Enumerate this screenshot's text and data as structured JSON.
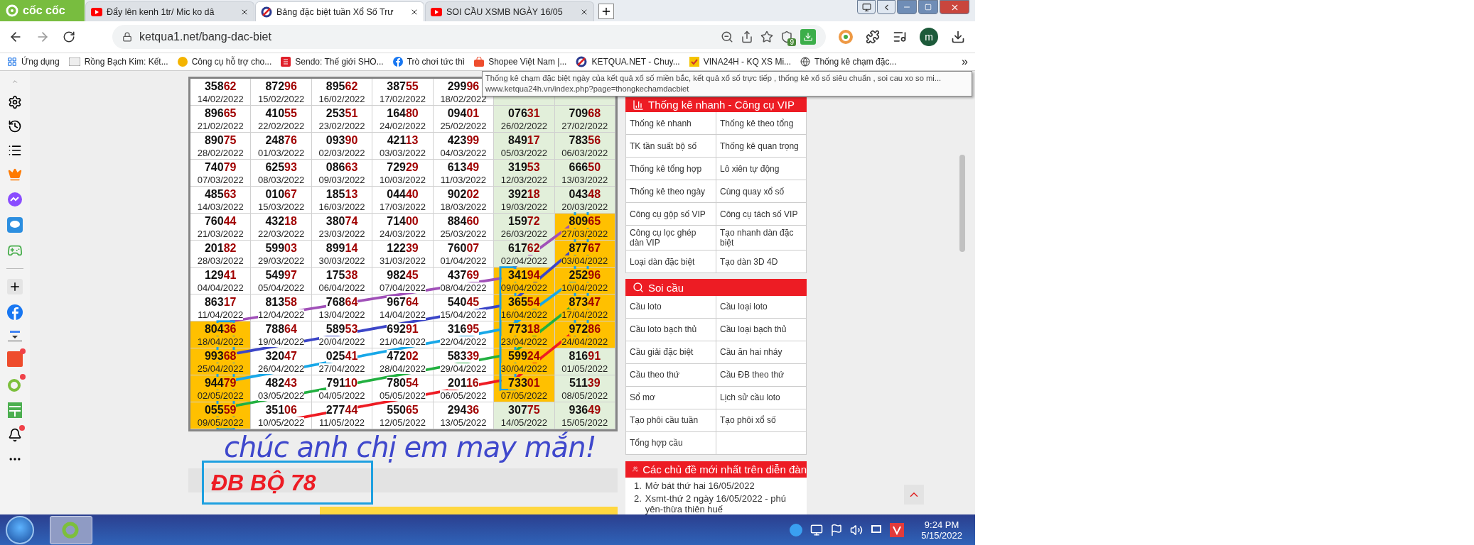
{
  "browser": {
    "brand": "cốc cốc",
    "tabs": [
      {
        "title": "Đẩy lên kenh 1tr/ Mic ko dâ",
        "kind": "video",
        "selected": false
      },
      {
        "title": "Bảng đặc biệt tuần Xổ Số Trư",
        "kind": "site",
        "selected": true
      },
      {
        "title": "SOI CẦU XSMB NGÀY 16/05",
        "kind": "video",
        "selected": false
      }
    ],
    "address": "ketqua1.net/bang-dac-biet",
    "shield_badge": "9",
    "profile_initial": "m",
    "bookmarks": [
      {
        "label": "Ứng dụng",
        "kind": "apps"
      },
      {
        "label": "Rồng Bạch Kim: Kết...",
        "kind": "rbk"
      },
      {
        "label": "Công cụ hỗ trợ cho...",
        "kind": "xs"
      },
      {
        "label": "Sendo: Thế giới SHO...",
        "kind": "sendo"
      },
      {
        "label": "Trò chơi tức thì",
        "kind": "facebook"
      },
      {
        "label": "Shopee Việt Nam |...",
        "kind": "shopee"
      },
      {
        "label": "KETQUA.NET - Chuy...",
        "kind": "site"
      },
      {
        "label": "VINA24H - KQ XS Mi...",
        "kind": "vina"
      },
      {
        "label": "Thống kê chạm đặc...",
        "kind": "globe"
      }
    ],
    "more_bookmarks": "»"
  },
  "tooltip": {
    "title": "Thống kê chạm đặc biệt ngày của kết quả xổ số miền bắc, kết quả xổ số trực tiếp , thống kê xổ số siêu chuẩn , soi cau xo so mi...",
    "url": "www.ketqua24h.vn/index.php?page=thongkechamdacbiet"
  },
  "table": {
    "rows": [
      [
        {
          "number": "35862",
          "date": "14/02/2022",
          "highlight": false
        },
        {
          "number": "87296",
          "date": "15/02/2022",
          "highlight": false
        },
        {
          "number": "89562",
          "date": "16/02/2022",
          "highlight": false
        },
        {
          "number": "38755",
          "date": "17/02/2022",
          "highlight": false
        },
        {
          "number": "29996",
          "date": "18/02/2022",
          "highlight": false
        },
        {
          "highlight": false
        },
        {
          "highlight": false
        }
      ],
      [
        {
          "number": "89665",
          "date": "21/02/2022",
          "highlight": false
        },
        {
          "number": "41055",
          "date": "22/02/2022",
          "highlight": false
        },
        {
          "number": "25351",
          "date": "23/02/2022",
          "highlight": false
        },
        {
          "number": "16480",
          "date": "24/02/2022",
          "highlight": false
        },
        {
          "number": "09401",
          "date": "25/02/2022",
          "highlight": false
        },
        {
          "number": "07631",
          "date": "26/02/2022",
          "highlight": false
        },
        {
          "number": "70968",
          "date": "27/02/2022",
          "highlight": false
        }
      ],
      [
        {
          "number": "89075",
          "date": "28/02/2022",
          "highlight": false
        },
        {
          "number": "24876",
          "date": "01/03/2022",
          "highlight": false
        },
        {
          "number": "09390",
          "date": "02/03/2022",
          "highlight": false
        },
        {
          "number": "42113",
          "date": "03/03/2022",
          "highlight": false
        },
        {
          "number": "42399",
          "date": "04/03/2022",
          "highlight": false
        },
        {
          "number": "84917",
          "date": "05/03/2022",
          "highlight": false
        },
        {
          "number": "78356",
          "date": "06/03/2022",
          "highlight": false
        }
      ],
      [
        {
          "number": "74079",
          "date": "07/03/2022",
          "highlight": false
        },
        {
          "number": "62593",
          "date": "08/03/2022",
          "highlight": false
        },
        {
          "number": "08663",
          "date": "09/03/2022",
          "highlight": false
        },
        {
          "number": "72929",
          "date": "10/03/2022",
          "highlight": false
        },
        {
          "number": "61349",
          "date": "11/03/2022",
          "highlight": false
        },
        {
          "number": "31953",
          "date": "12/03/2022",
          "highlight": false
        },
        {
          "number": "66650",
          "date": "13/03/2022",
          "highlight": false
        }
      ],
      [
        {
          "number": "48563",
          "date": "14/03/2022",
          "highlight": false
        },
        {
          "number": "01067",
          "date": "15/03/2022",
          "highlight": false
        },
        {
          "number": "18513",
          "date": "16/03/2022",
          "highlight": false
        },
        {
          "number": "04440",
          "date": "17/03/2022",
          "highlight": false
        },
        {
          "number": "90202",
          "date": "18/03/2022",
          "highlight": false
        },
        {
          "number": "39218",
          "date": "19/03/2022",
          "highlight": false
        },
        {
          "number": "04348",
          "date": "20/03/2022",
          "highlight": false
        }
      ],
      [
        {
          "number": "76044",
          "date": "21/03/2022",
          "highlight": false
        },
        {
          "number": "43218",
          "date": "22/03/2022",
          "highlight": false
        },
        {
          "number": "38074",
          "date": "23/03/2022",
          "highlight": false
        },
        {
          "number": "71400",
          "date": "24/03/2022",
          "highlight": false
        },
        {
          "number": "88460",
          "date": "25/03/2022",
          "highlight": false
        },
        {
          "number": "15972",
          "date": "26/03/2022",
          "highlight": false
        },
        {
          "number": "80965",
          "date": "27/03/2022",
          "highlight": true
        }
      ],
      [
        {
          "number": "20182",
          "date": "28/03/2022",
          "highlight": false
        },
        {
          "number": "59903",
          "date": "29/03/2022",
          "highlight": false
        },
        {
          "number": "89914",
          "date": "30/03/2022",
          "highlight": false
        },
        {
          "number": "12239",
          "date": "31/03/2022",
          "highlight": false
        },
        {
          "number": "76007",
          "date": "01/04/2022",
          "highlight": false
        },
        {
          "number": "61762",
          "date": "02/04/2022",
          "highlight": false
        },
        {
          "number": "87767",
          "date": "03/04/2022",
          "highlight": true
        }
      ],
      [
        {
          "number": "12941",
          "date": "04/04/2022",
          "highlight": false
        },
        {
          "number": "54997",
          "date": "05/04/2022",
          "highlight": false
        },
        {
          "number": "17538",
          "date": "06/04/2022",
          "highlight": false
        },
        {
          "number": "98245",
          "date": "07/04/2022",
          "highlight": false
        },
        {
          "number": "43769",
          "date": "08/04/2022",
          "highlight": false
        },
        {
          "number": "34194",
          "date": "09/04/2022",
          "highlight": true
        },
        {
          "number": "25296",
          "date": "10/04/2022",
          "highlight": true
        }
      ],
      [
        {
          "number": "86317",
          "date": "11/04/2022",
          "highlight": false
        },
        {
          "number": "81358",
          "date": "12/04/2022",
          "highlight": false
        },
        {
          "number": "76864",
          "date": "13/04/2022",
          "highlight": false
        },
        {
          "number": "96764",
          "date": "14/04/2022",
          "highlight": false
        },
        {
          "number": "54045",
          "date": "15/04/2022",
          "highlight": false
        },
        {
          "number": "36554",
          "date": "16/04/2022",
          "highlight": true
        },
        {
          "number": "87347",
          "date": "17/04/2022",
          "highlight": true
        }
      ],
      [
        {
          "number": "80436",
          "date": "18/04/2022",
          "highlight": true
        },
        {
          "number": "78864",
          "date": "19/04/2022",
          "highlight": false
        },
        {
          "number": "58953",
          "date": "20/04/2022",
          "highlight": false
        },
        {
          "number": "69291",
          "date": "21/04/2022",
          "highlight": false
        },
        {
          "number": "31695",
          "date": "22/04/2022",
          "highlight": false
        },
        {
          "number": "77318",
          "date": "23/04/2022",
          "highlight": true
        },
        {
          "number": "97286",
          "date": "24/04/2022",
          "highlight": true
        }
      ],
      [
        {
          "number": "99368",
          "date": "25/04/2022",
          "highlight": true
        },
        {
          "number": "32047",
          "date": "26/04/2022",
          "highlight": false
        },
        {
          "number": "02541",
          "date": "27/04/2022",
          "highlight": false
        },
        {
          "number": "47202",
          "date": "28/04/2022",
          "highlight": false
        },
        {
          "number": "58339",
          "date": "29/04/2022",
          "highlight": false
        },
        {
          "number": "59924",
          "date": "30/04/2022",
          "highlight": true
        },
        {
          "number": "81691",
          "date": "01/05/2022",
          "highlight": false
        }
      ],
      [
        {
          "number": "94479",
          "date": "02/05/2022",
          "highlight": true
        },
        {
          "number": "48243",
          "date": "03/05/2022",
          "highlight": false
        },
        {
          "number": "79110",
          "date": "04/05/2022",
          "highlight": false
        },
        {
          "number": "78054",
          "date": "05/05/2022",
          "highlight": false
        },
        {
          "number": "20116",
          "date": "06/05/2022",
          "highlight": false
        },
        {
          "number": "73301",
          "date": "07/05/2022",
          "highlight": true
        },
        {
          "number": "51139",
          "date": "08/05/2022",
          "highlight": false
        }
      ],
      [
        {
          "number": "05559",
          "date": "09/05/2022",
          "highlight": true
        },
        {
          "number": "35106",
          "date": "10/05/2022",
          "highlight": false
        },
        {
          "number": "27744",
          "date": "11/05/2022",
          "highlight": false
        },
        {
          "number": "55065",
          "date": "12/05/2022",
          "highlight": false
        },
        {
          "number": "29436",
          "date": "13/05/2022",
          "highlight": false
        },
        {
          "number": "30775",
          "date": "14/05/2022",
          "highlight": false
        },
        {
          "number": "93649",
          "date": "15/05/2022",
          "highlight": false
        }
      ]
    ]
  },
  "annotation": {
    "greeting": "chúc anh chị em may mắn!",
    "label": "ĐB BỘ 78"
  },
  "panels": [
    {
      "title": "Thống kê nhanh - Công cụ VIP",
      "kind": "chart",
      "links": [
        "Thống kê nhanh",
        "Thống kê theo tổng",
        "TK tần suất bộ số",
        "Thống kê quan trọng",
        "Thống kê tổng hợp",
        "Lô xiên tự động",
        "Thống kê theo ngày",
        "Cùng quay xổ số",
        "Công cụ gộp số VIP",
        "Công cụ tách số VIP",
        "Công cụ lọc ghép dàn VIP",
        "Tạo nhanh dàn đặc biệt",
        "Loại dàn đặc biệt",
        "Tạo dàn 3D 4D"
      ]
    },
    {
      "title": "Soi cầu",
      "kind": "search",
      "links": [
        "Cầu loto",
        "Cầu loại loto",
        "Cầu loto bạch thủ",
        "Cầu loại bạch thủ",
        "Cầu giải đặc biệt",
        "Cầu ăn hai nháy",
        "Cầu theo thứ",
        "Cầu ĐB theo thứ",
        "Sổ mơ",
        "Lịch sử cầu loto",
        "Tạo phôi cầu tuần",
        "Tạo phôi xổ số",
        "Tổng hợp cầu"
      ]
    }
  ],
  "forum": {
    "title": "Các chủ đề mới nhất trên diễn đàn",
    "items": [
      {
        "number": "1.",
        "text": "Mở bát thứ hai 16/05/2022"
      },
      {
        "number": "2.",
        "text": "Xsmt-thứ 2 ngày 16/05/2022 - phú yên-thừa thiên huế"
      }
    ]
  },
  "taskbar": {
    "time": "9:24 PM",
    "date": "5/15/2022"
  }
}
